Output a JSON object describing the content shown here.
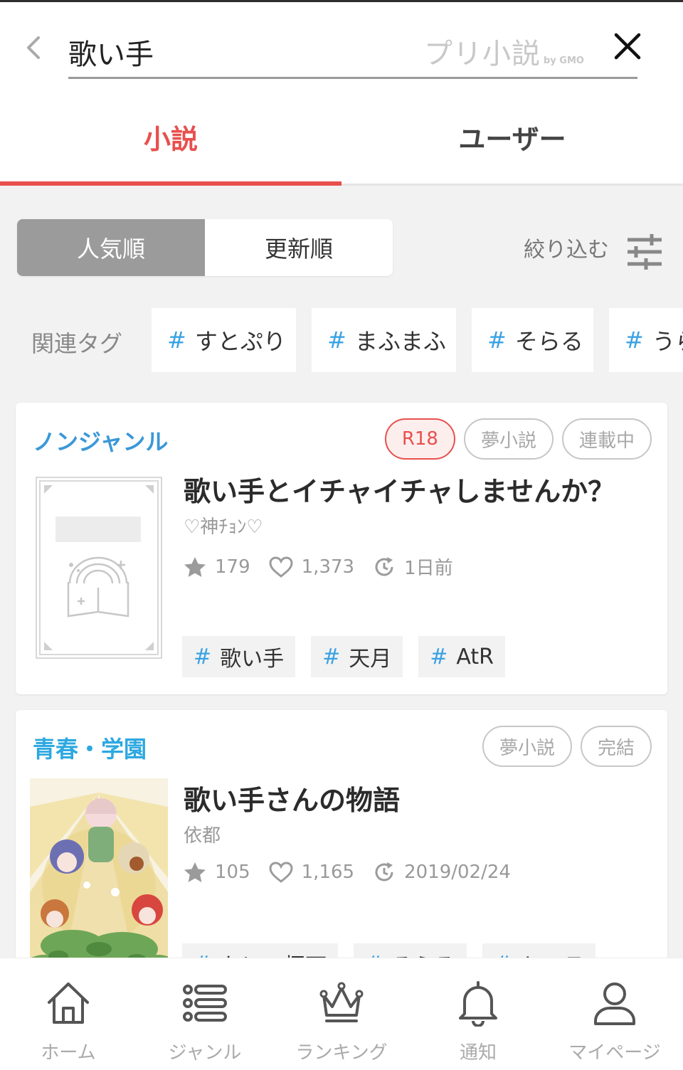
{
  "header": {
    "search_value": "歌い手",
    "brand_main": "プリ小説",
    "brand_sub": "by GMO"
  },
  "tabs": [
    {
      "label": "小説",
      "active": true
    },
    {
      "label": "ユーザー",
      "active": false
    }
  ],
  "sort": {
    "popular": "人気順",
    "updated": "更新順",
    "active": "popular",
    "filter_label": "絞り込む"
  },
  "related": {
    "label": "関連タグ",
    "tags": [
      "すとぷり",
      "まふまふ",
      "そらる",
      "うら"
    ]
  },
  "results": [
    {
      "genre": "ノンジャンル",
      "badges": [
        "R18",
        "夢小説",
        "連載中"
      ],
      "title": "歌い手とイチャイチャしませんか？",
      "author": "♡神ﾁｮﾝ♡",
      "stars": "179",
      "likes": "1,373",
      "updated": "1日前",
      "tags": [
        "歌い手",
        "天月",
        "AtR"
      ]
    },
    {
      "genre": "青春・学園",
      "badges": [
        "夢小説",
        "完結"
      ],
      "title": "歌い手さんの物語",
      "author": "依都",
      "stars": "105",
      "likes": "1,165",
      "updated": "2019/02/24",
      "tags": [
        "なにの栢可",
        "そらる",
        "センラ"
      ]
    }
  ],
  "nav": [
    {
      "label": "ホーム",
      "icon": "home-icon"
    },
    {
      "label": "ジャンル",
      "icon": "list-icon"
    },
    {
      "label": "ランキング",
      "icon": "crown-icon"
    },
    {
      "label": "通知",
      "icon": "bell-icon"
    },
    {
      "label": "マイページ",
      "icon": "user-icon"
    }
  ],
  "colors": {
    "accent": "#e8504d",
    "tag_hash": "#3aa2e2",
    "genre": "#3a98d8"
  }
}
